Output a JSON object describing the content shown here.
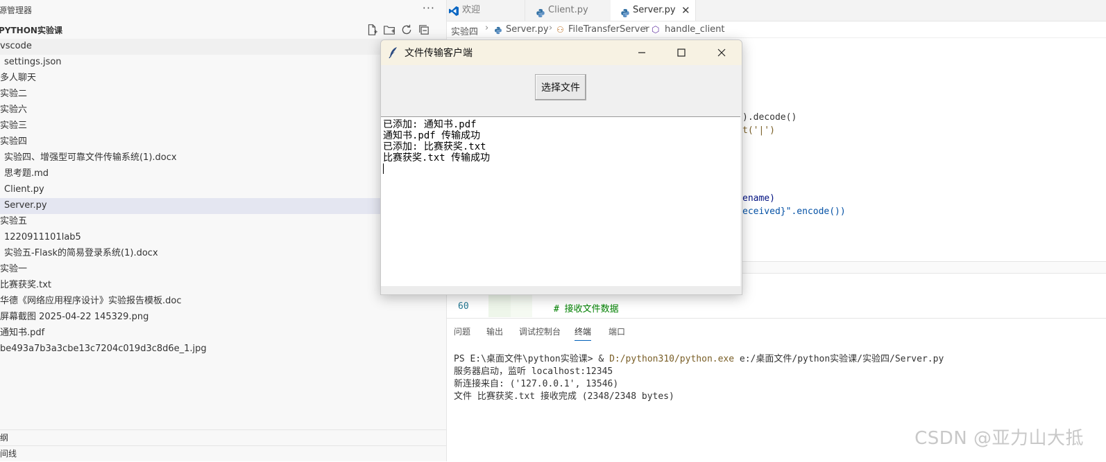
{
  "explorer": {
    "title": "源管理器",
    "more": "···",
    "folder": "PYTHON实验课",
    "items": [
      {
        "label": "vscode",
        "depth": 0
      },
      {
        "label": "settings.json",
        "depth": 1
      },
      {
        "label": "多人聊天",
        "depth": 0
      },
      {
        "label": "实验二",
        "depth": 0
      },
      {
        "label": "实验六",
        "depth": 0
      },
      {
        "label": "实验三",
        "depth": 0
      },
      {
        "label": "实验四",
        "depth": 0
      },
      {
        "label": "实验四、增强型可靠文件传输系统(1).docx",
        "depth": 1
      },
      {
        "label": "思考题.md",
        "depth": 1
      },
      {
        "label": "Client.py",
        "depth": 1
      },
      {
        "label": "Server.py",
        "depth": 1
      },
      {
        "label": "实验五",
        "depth": 0
      },
      {
        "label": "1220911101lab5",
        "depth": 1
      },
      {
        "label": "实验五-Flask的简易登录系统(1).docx",
        "depth": 1
      },
      {
        "label": "实验一",
        "depth": 0
      },
      {
        "label": "比赛获奖.txt",
        "depth": 0
      },
      {
        "label": "华德《网络应用程序设计》实验报告模板.doc",
        "depth": 0
      },
      {
        "label": "屏幕截图 2025-04-22 145329.png",
        "depth": 0
      },
      {
        "label": "通知书.pdf",
        "depth": 0
      },
      {
        "label": "be493a7b3a3cbe13c7204c019d3c8d6e_1.jpg",
        "depth": 0
      }
    ],
    "outline": "纲",
    "timeline": "间线"
  },
  "tabs": [
    {
      "label": "欢迎",
      "icon": "vscode-icon"
    },
    {
      "label": "Client.py",
      "icon": "python-icon"
    },
    {
      "label": "Server.py",
      "icon": "python-icon",
      "close": "✕"
    }
  ],
  "breadcrumb": {
    "folder": "实验四",
    "file": "Server.py",
    "class": "FileTransferServer",
    "method": "handle_client",
    "sep": "›"
  },
  "code": {
    "line_a": ").decode()",
    "line_b": "t('|')",
    "line_c": "ename)",
    "line_d": "eceived}\".encode())",
    "line_no": "60",
    "comment": "# 接收文件数据"
  },
  "panel": {
    "tabs": [
      "问题",
      "输出",
      "调试控制台",
      "终端",
      "端口"
    ],
    "active_tab": "终端",
    "terminal": {
      "prompt": "PS E:\\桌面文件\\python实验课> & ",
      "exe": "D:/python310/python.exe",
      "script": " e:/桌面文件/python实验课/实验四/Server.py",
      "lines": [
        "服务器启动，监听 localhost:12345",
        "新连接来自: ('127.0.0.1', 13546)",
        "文件 比赛获奖.txt 接收完成 (2348/2348 bytes)"
      ]
    }
  },
  "tk_window": {
    "title": "文件传输客户端",
    "button": "选择文件",
    "log": [
      "已添加: 通知书.pdf",
      "通知书.pdf 传输成功",
      "已添加: 比赛获奖.txt",
      "比赛获奖.txt 传输成功"
    ]
  },
  "watermark": "CSDN @亚力山大抵",
  "colors": {
    "accent": "#005fb8",
    "selected_row": "#e4e6f1",
    "exe_path": "#795e26"
  }
}
